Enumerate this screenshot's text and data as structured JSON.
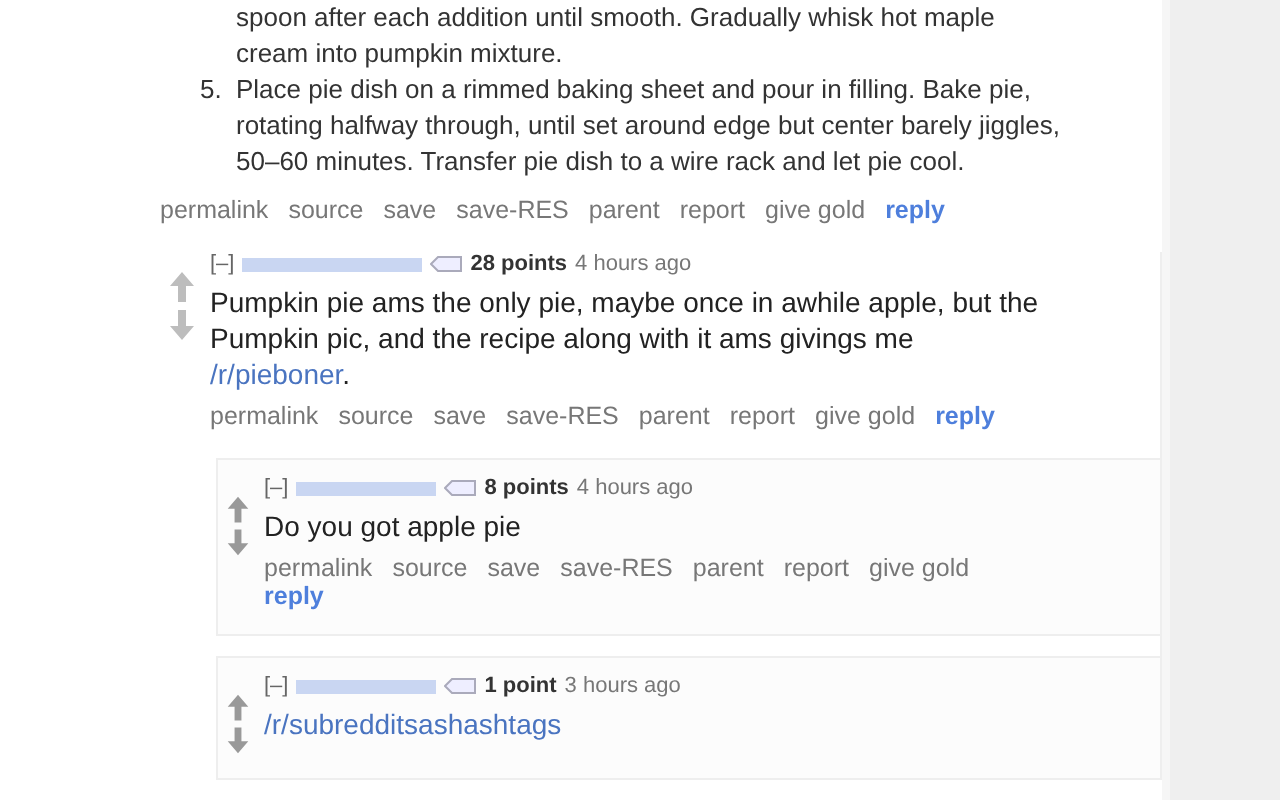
{
  "parent_comment": {
    "steps": [
      {
        "text": "spoon after each addition until smooth. Gradually whisk hot maple cream into pumpkin mixture."
      },
      {
        "number": "5.",
        "text": "Place pie dish on a rimmed baking sheet and pour in filling. Bake pie, rotating halfway through, until set around edge but center barely jiggles, 50–60 minutes. Transfer pie dish to a wire rack and let pie cool."
      }
    ],
    "actions": [
      {
        "label": "permalink",
        "kind": "plain"
      },
      {
        "label": "source",
        "kind": "plain"
      },
      {
        "label": "save",
        "kind": "plain"
      },
      {
        "label": "save-RES",
        "kind": "plain"
      },
      {
        "label": "parent",
        "kind": "plain"
      },
      {
        "label": "report",
        "kind": "plain"
      },
      {
        "label": "give gold",
        "kind": "plain"
      },
      {
        "label": "reply",
        "kind": "reply"
      }
    ]
  },
  "comments": [
    {
      "collapse": "[–]",
      "points": "28 points",
      "time": "4 hours ago",
      "body": [
        {
          "kind": "text",
          "text": "Pumpkin pie ams the only pie, maybe once in awhile apple, but the Pumpkin pic, and the recipe along with it ams givings me "
        },
        {
          "kind": "link",
          "text": "/r/pieboner"
        },
        {
          "kind": "text",
          "text": "."
        }
      ],
      "actions": [
        {
          "label": "permalink",
          "kind": "plain"
        },
        {
          "label": "source",
          "kind": "plain"
        },
        {
          "label": "save",
          "kind": "plain"
        },
        {
          "label": "save-RES",
          "kind": "plain"
        },
        {
          "label": "parent",
          "kind": "plain"
        },
        {
          "label": "report",
          "kind": "plain"
        },
        {
          "label": "give gold",
          "kind": "plain"
        },
        {
          "label": "reply",
          "kind": "reply"
        }
      ],
      "replies": [
        {
          "collapse": "[–]",
          "points": "8 points",
          "time": "4 hours ago",
          "body": [
            {
              "kind": "text",
              "text": "Do you got apple pie"
            }
          ],
          "actions": [
            {
              "label": "permalink",
              "kind": "plain"
            },
            {
              "label": "source",
              "kind": "plain"
            },
            {
              "label": "save",
              "kind": "plain"
            },
            {
              "label": "save-RES",
              "kind": "plain"
            },
            {
              "label": "parent",
              "kind": "plain"
            },
            {
              "label": "report",
              "kind": "plain"
            },
            {
              "label": "give gold",
              "kind": "plain"
            },
            {
              "label": "reply",
              "kind": "reply"
            }
          ]
        },
        {
          "collapse": "[–]",
          "points": "1 point",
          "time": "3 hours ago",
          "body": [
            {
              "kind": "link",
              "text": "/r/subredditsashashtags"
            }
          ]
        }
      ]
    }
  ]
}
